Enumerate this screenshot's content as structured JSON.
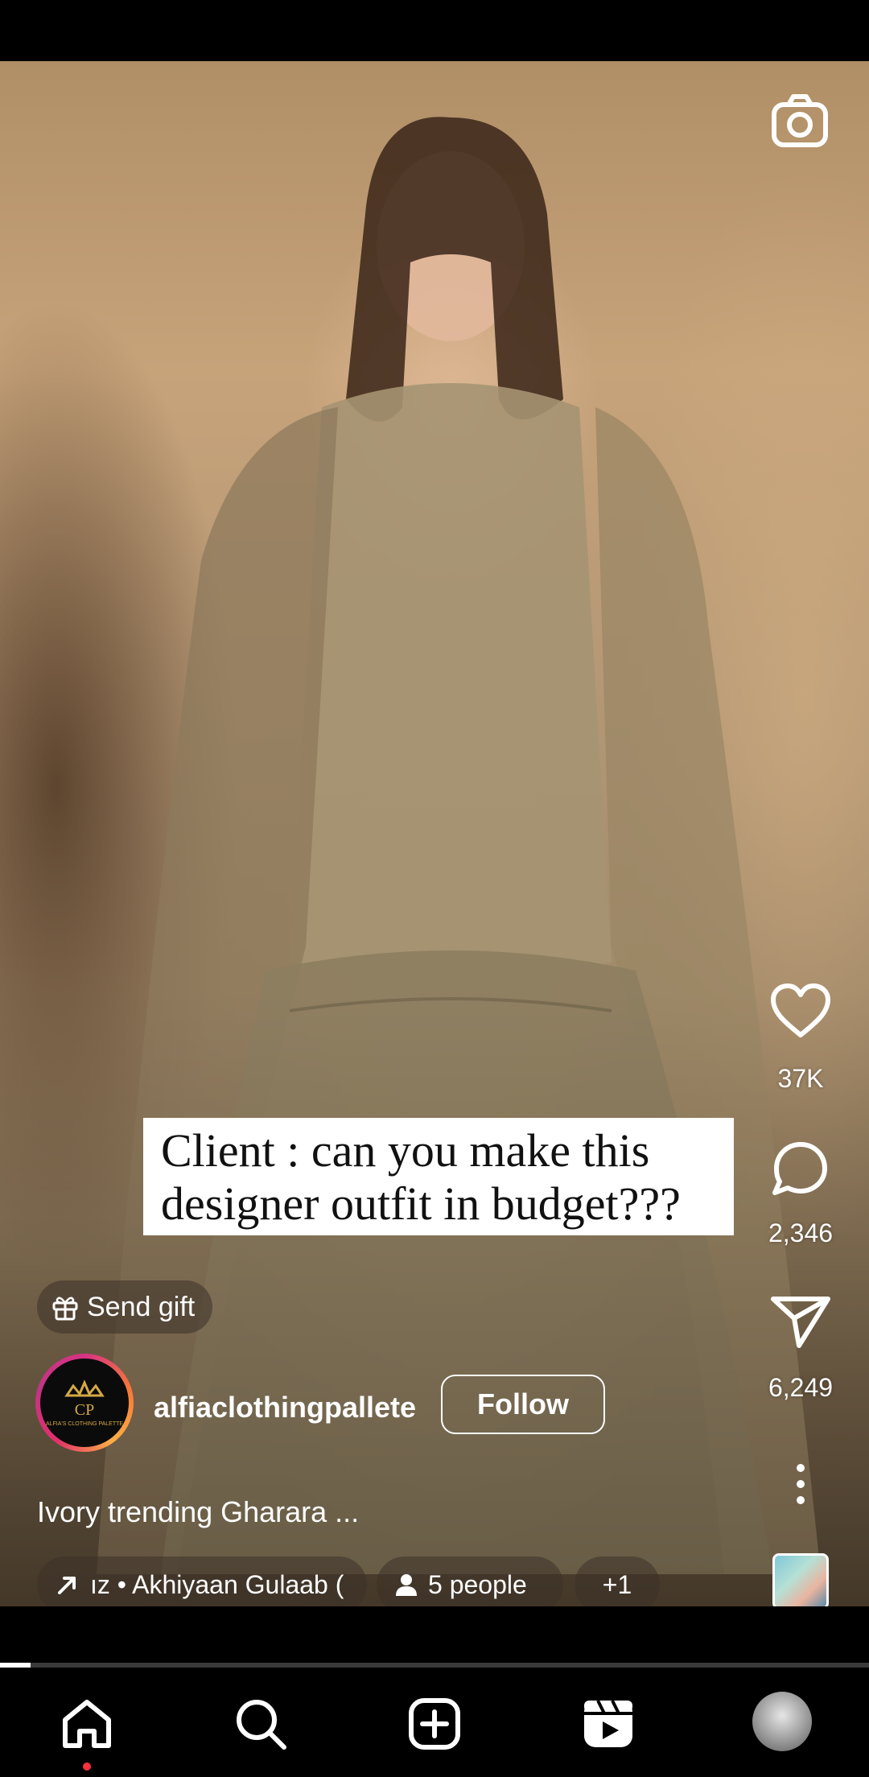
{
  "reel": {
    "overlay_caption": "Client : can you make this\ndesigner outfit in budget???",
    "likes": "37K",
    "comments": "2,346",
    "shares": "6,249",
    "send_gift_label": "Send gift",
    "username": "alfiaclothingpallete",
    "follow_label": "Follow",
    "caption": "Ivory trending Gharara ...",
    "music_text": "ız • Akhiyaan Gulaab (",
    "people_label": "5 people",
    "more_chip": "+1",
    "avatar_brand_text": "ALFIA'S CLOTHING PALETTE",
    "progress": 0.035
  },
  "icons": {
    "camera": "camera-icon",
    "like": "heart-icon",
    "comment": "comment-icon",
    "share": "send-icon",
    "more": "more-vertical-icon",
    "gift": "gift-icon",
    "music": "arrow-trending-icon",
    "people": "person-icon",
    "nav_home": "home-icon",
    "nav_search": "search-icon",
    "nav_create": "add-square-icon",
    "nav_reels": "reels-icon"
  },
  "colors": {
    "notification_dot": "#ff3040",
    "avatar_ring": "#d63384"
  }
}
